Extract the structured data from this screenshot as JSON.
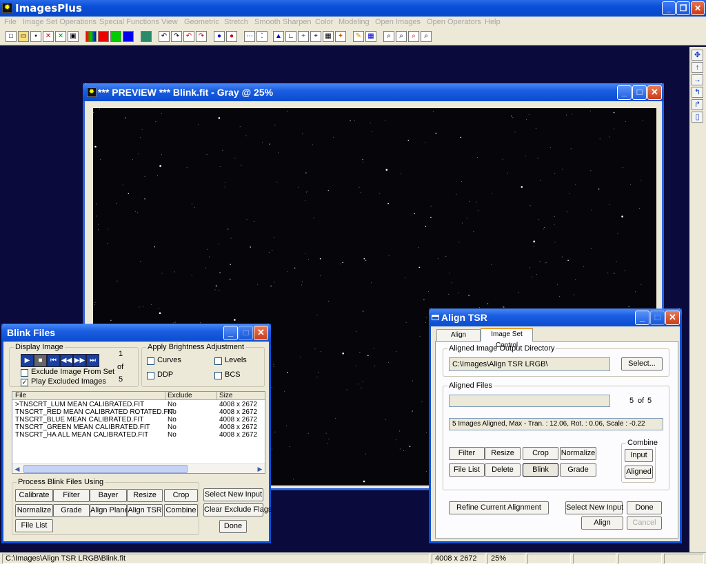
{
  "app": {
    "title": "ImagesPlus"
  },
  "menu": [
    "File",
    "Image Set Operations",
    "Special Functions",
    "View",
    "Geometric",
    "Stretch",
    "Smooth Sharpen",
    "Color",
    "Modeling",
    "Open Images",
    "Open Operators",
    "Help"
  ],
  "preview": {
    "title": "*** PREVIEW *** Blink.fit - Gray @ 25%"
  },
  "blink": {
    "title": "Blink Files",
    "display_label": "Display Image",
    "counter_current": "1",
    "counter_of": "of",
    "counter_total": "5",
    "exclude_label": "Exclude Image From Set",
    "play_label": "Play Excluded Images",
    "brightness_label": "Apply Brightness Adjustment",
    "curves": "Curves",
    "levels": "Levels",
    "ddp": "DDP",
    "bcs": "BCS",
    "cols": [
      "File",
      "Exclude",
      "Size"
    ],
    "rows": [
      [
        ">TNSCRT_LUM MEAN CALIBRATED.FIT",
        "No",
        "4008 x 2672"
      ],
      [
        "TNSCRT_RED MEAN CALIBRATED ROTATED.FIT",
        "No",
        "4008 x 2672"
      ],
      [
        "TNSCRT_BLUE MEAN CALIBRATED.FIT",
        "No",
        "4008 x 2672"
      ],
      [
        "TNSCRT_GREEN MEAN CALIBRATED.FIT",
        "No",
        "4008 x 2672"
      ],
      [
        "TNSCRT_HA ALL MEAN CALIBRATED.FIT",
        "No",
        "4008 x 2672"
      ]
    ],
    "process_label": "Process Blink Files Using",
    "btns": {
      "calibrate": "Calibrate",
      "filter": "Filter",
      "bayer": "Bayer",
      "resize": "Resize",
      "crop": "Crop",
      "normalize": "Normalize",
      "grade": "Grade",
      "align_planet": "Align Planet",
      "align_tsr": "Align TSR",
      "combine": "Combine",
      "file_list": "File List",
      "select_new_input": "Select New Input",
      "clear_exclude": "Clear Exclude Flags",
      "done": "Done"
    }
  },
  "align": {
    "title": "Align TSR",
    "tab1": "Align Methods",
    "tab2": "Image Set Control",
    "outdir_label": "Aligned Image Output Directory",
    "outdir": "C:\\Images\\Align TSR LRGB\\",
    "select": "Select...",
    "files_label": "Aligned Files",
    "count_current": "5",
    "count_of": "of",
    "count_total": "5",
    "summary": "5 Images Aligned, Max - Tran. : 12.06, Rot. :  0.06, Scale : -0.22",
    "combine_label": "Combine",
    "btns": {
      "filter": "Filter",
      "resize": "Resize",
      "crop": "Crop",
      "normalize": "Normalize",
      "file_list": "File List",
      "delete": "Delete",
      "blink": "Blink",
      "grade": "Grade",
      "input": "Input",
      "aligned": "Aligned",
      "refine": "Refine Current Alignment",
      "select_new_input": "Select New Input",
      "done": "Done",
      "align": "Align",
      "cancel": "Cancel"
    }
  },
  "status": {
    "path": "C:\\Images\\Align TSR LRGB\\Blink.fit",
    "size": "4008 x 2672",
    "zoom": "25%"
  }
}
